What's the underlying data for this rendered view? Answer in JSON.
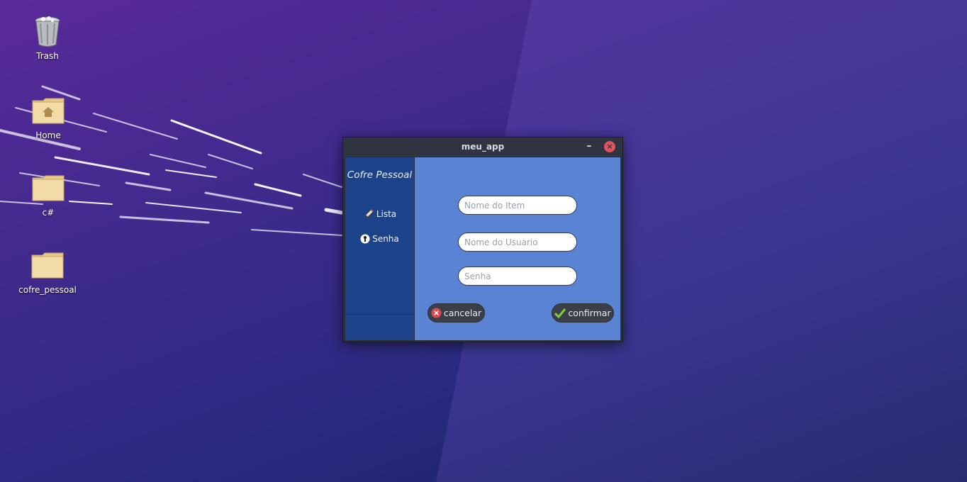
{
  "desktop": {
    "icons": [
      {
        "label": "Trash",
        "icon": "trash-icon"
      },
      {
        "label": "Home",
        "icon": "home-folder-icon"
      },
      {
        "label": "c#",
        "icon": "folder-icon"
      },
      {
        "label": "cofre_pessoal",
        "icon": "folder-icon"
      }
    ]
  },
  "window": {
    "title": "meu_app",
    "minimize_label": "–",
    "close_label": "×",
    "sidebar": {
      "app_title": "Cofre Pessoal",
      "items": [
        {
          "label": "Lista",
          "icon": "pencil-icon"
        },
        {
          "label": "Senha",
          "icon": "keyhole-icon"
        }
      ]
    },
    "form": {
      "fields": [
        {
          "placeholder": "Nome do Item",
          "value": ""
        },
        {
          "placeholder": "Nome do Usuario",
          "value": ""
        },
        {
          "placeholder": "Senha",
          "value": ""
        }
      ],
      "cancel_label": "cancelar",
      "confirm_label": "confirmar"
    }
  },
  "colors": {
    "sidebar_bg": "#1c4289",
    "content_bg": "#5a84d3",
    "titlebar_bg": "#2f3440",
    "close_button": "#e0555a",
    "button_bg": "#3b3f48"
  }
}
